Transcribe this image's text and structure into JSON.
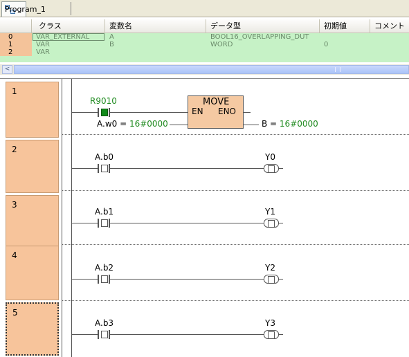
{
  "tab": {
    "label": "Program_1"
  },
  "grid": {
    "columns": [
      "クラス",
      "変数名",
      "データ型",
      "初期値",
      "コメント"
    ],
    "rows": [
      {
        "index": "0",
        "class": "VAR_EXTERNAL",
        "name": "A",
        "type": "BOOL16_OVERLAPPING_DUT",
        "init": ""
      },
      {
        "index": "1",
        "class": "VAR",
        "name": "B",
        "type": "WORD",
        "init": "0"
      },
      {
        "index": "2",
        "class": "VAR",
        "name": "",
        "type": "",
        "init": ""
      }
    ],
    "scroll_arrow": "<"
  },
  "ladder": {
    "rungs": [
      "1",
      "2",
      "3",
      "4",
      "5"
    ],
    "rung1": {
      "contact_label": "R9010",
      "block_title": "MOVE",
      "en": "EN",
      "eno": "ENO",
      "input_var": "A.w0",
      "input_eq": " = ",
      "input_val": "16#0000",
      "output_var": "B",
      "output_eq": " = ",
      "output_val": "16#0000"
    },
    "rung2": {
      "contact": "A.b0",
      "coil": "Y0"
    },
    "rung3": {
      "contact": "A.b1",
      "coil": "Y1"
    },
    "rung4": {
      "contact": "A.b2",
      "coil": "Y2"
    },
    "rung5": {
      "contact": "A.b3",
      "coil": "Y3"
    }
  },
  "colors": {
    "contact_on": "#118a1a",
    "value_text": "#1e8a1e",
    "rung_number_bg": "#f7c49b",
    "grid_bg": "#c6f2c6"
  }
}
